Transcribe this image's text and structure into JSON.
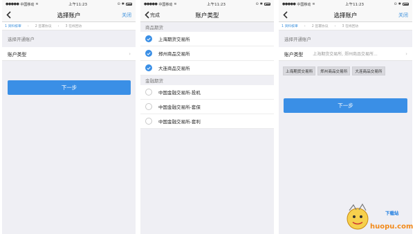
{
  "status_bar": {
    "carrier": "中国移动",
    "time": "上午11:23"
  },
  "screen1": {
    "title": "选择账户",
    "close_label": "关闭",
    "steps": [
      "1 资料核审",
      "2 签署协议",
      "3 在线回访"
    ],
    "section_label": "选择开通账户",
    "account_type_label": "账户类型",
    "next_button": "下一步"
  },
  "screen2": {
    "back_label": "完成",
    "title": "账户类型",
    "groups": [
      {
        "header": "商品期货",
        "options": [
          {
            "label": "上海期货交易所",
            "checked": true
          },
          {
            "label": "郑州商品交易所",
            "checked": true
          },
          {
            "label": "大连商品交易所",
            "checked": true
          }
        ]
      },
      {
        "header": "金融期货",
        "options": [
          {
            "label": "中国金融交易所-投机",
            "checked": false
          },
          {
            "label": "中国金融交易所-套保",
            "checked": false
          },
          {
            "label": "中国金融交易所-套利",
            "checked": false
          }
        ]
      }
    ]
  },
  "screen3": {
    "title": "选择账户",
    "close_label": "关闭",
    "steps": [
      "1 资料核审",
      "2 签署协议",
      "3 在线回访"
    ],
    "section_label": "选择开通账户",
    "account_type_label": "账户类型",
    "account_type_value": "上海期货交易所, 郑州商品交易所...",
    "tags": [
      "上海期货交易所",
      "郑州商品交易所",
      "大连商品交易所"
    ],
    "next_button": "下一步"
  },
  "watermark": {
    "text": "huopu.com",
    "sub": "下载站"
  },
  "colors": {
    "accent": "#3a8fe6",
    "link": "#3a8fdc",
    "background": "#efeff4"
  }
}
